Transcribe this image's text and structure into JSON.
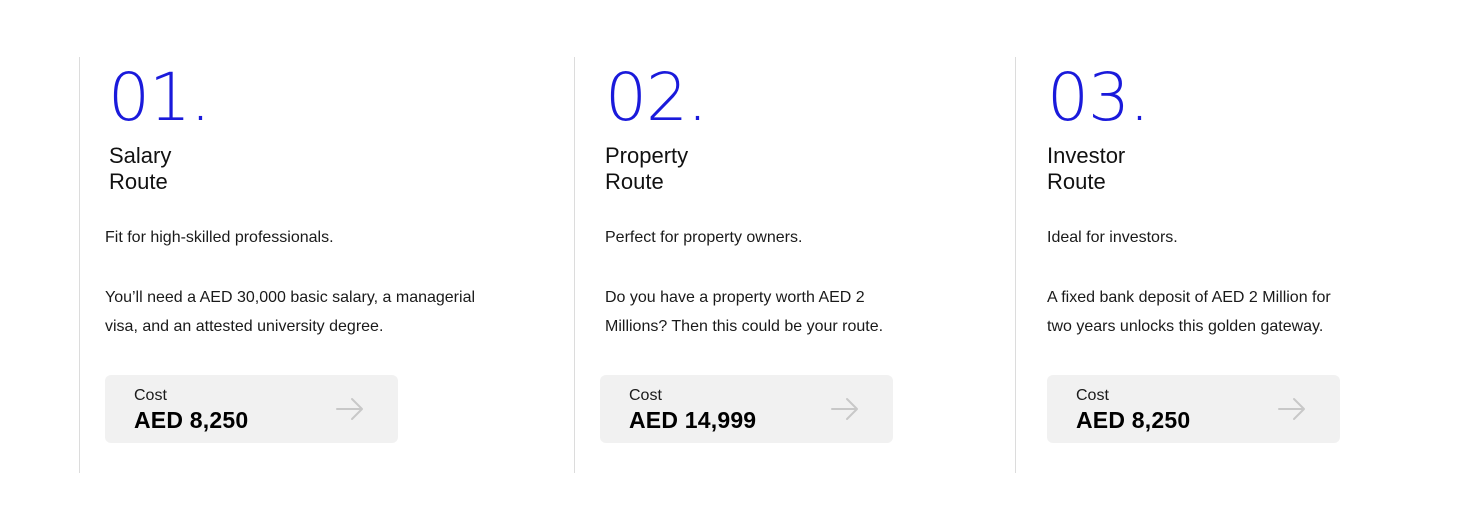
{
  "routes": [
    {
      "number": "01",
      "dot": ".",
      "title": "Salary\nRoute",
      "tagline": "Fit for high-skilled professionals.",
      "description_line1": "You’ll need a AED 30,000 basic salary, a managerial",
      "description_line2": "visa, and an attested university degree.",
      "cost_label": "Cost",
      "cost_value": "AED 8,250"
    },
    {
      "number": "02",
      "dot": ".",
      "title": "Property\nRoute",
      "tagline": "Perfect for property owners.",
      "description_line1": "Do you have a property worth AED 2",
      "description_line2": "Millions? Then this could be your route.",
      "cost_label": "Cost",
      "cost_value": "AED 14,999"
    },
    {
      "number": "03",
      "dot": ".",
      "title": "Investor\nRoute",
      "tagline": "Ideal for investors.",
      "description_line1": "A fixed bank deposit of AED 2 Million for",
      "description_line2": "two years unlocks this golden gateway.",
      "cost_label": "Cost",
      "cost_value": "AED 8,250"
    }
  ],
  "colors": {
    "accent": "#1a1adb",
    "cost_box_bg": "#f1f1f1",
    "divider": "#dcdcdc",
    "arrow": "#c8c8c8"
  },
  "icons": {
    "cost_arrow": "arrow-right-icon"
  }
}
